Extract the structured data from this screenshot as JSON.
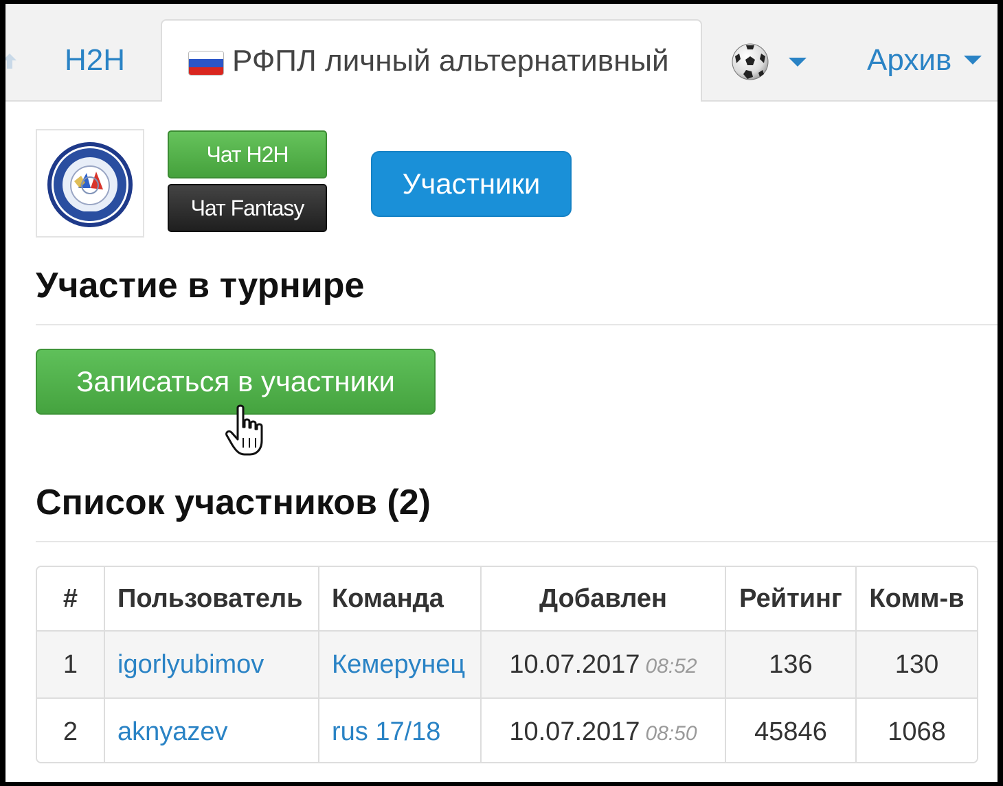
{
  "tabs": {
    "h2h": "H2H",
    "active": "РФПЛ личный альтернативный",
    "archive": "Архив"
  },
  "icons": {
    "back": "arrow-up-icon",
    "flag": "russia-flag-icon",
    "ball": "soccer-ball-icon",
    "caret": "chevron-down-icon",
    "logo": "league-logo",
    "cursor": "hand-pointer-cursor"
  },
  "colors": {
    "link": "#2a83c5",
    "primary": "#1a90d8",
    "success": "#45a33f",
    "dark": "#1f1f1f"
  },
  "header": {
    "chat_h2h": "Чат H2H",
    "chat_fantasy": "Чат Fantasy",
    "participants": "Участники"
  },
  "participation": {
    "title": "Участие в турнире",
    "signup": "Записаться в участники"
  },
  "participants_list": {
    "title": "Список участников (2)",
    "columns": [
      "#",
      "Пользователь",
      "Команда",
      "Добавлен",
      "Рейтинг",
      "Комм-в"
    ],
    "rows": [
      {
        "num": "1",
        "user": "igorlyubimov",
        "team": "Кемерунец",
        "date": "10.07.2017",
        "time": "08:52",
        "rating": "136",
        "comments": "130"
      },
      {
        "num": "2",
        "user": "aknyazev",
        "team": "rus 17/18",
        "date": "10.07.2017",
        "time": "08:50",
        "rating": "45846",
        "comments": "1068"
      }
    ]
  }
}
